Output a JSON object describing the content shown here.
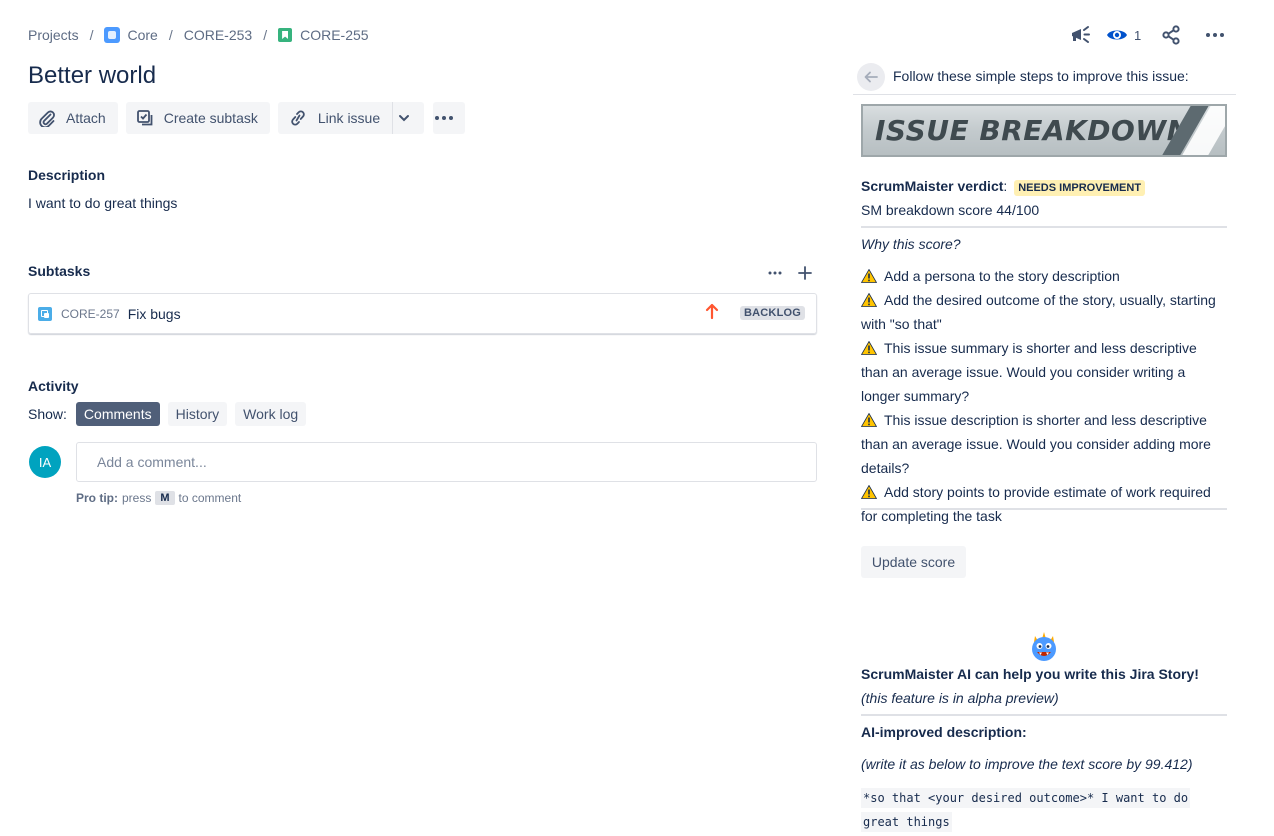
{
  "breadcrumb": {
    "projects": "Projects",
    "project": "Core",
    "parent": "CORE-253",
    "current": "CORE-255",
    "separator": "/"
  },
  "header": {
    "watch_count": "1"
  },
  "issue": {
    "title": "Better world"
  },
  "toolbar": {
    "attach": "Attach",
    "create_subtask": "Create subtask",
    "link_issue": "Link issue"
  },
  "description": {
    "heading": "Description",
    "text": "I want to do great things"
  },
  "subtasks": {
    "heading": "Subtasks",
    "items": [
      {
        "key": "CORE-257",
        "summary": "Fix bugs",
        "priority": "High",
        "status": "BACKLOG"
      }
    ]
  },
  "activity": {
    "heading": "Activity",
    "show_label": "Show:",
    "tabs": [
      {
        "label": "Comments",
        "active": true
      },
      {
        "label": "History",
        "active": false
      },
      {
        "label": "Work log",
        "active": false
      }
    ],
    "avatar_initials": "IA",
    "comment_placeholder": "Add a comment...",
    "pro_tip_label": "Pro tip:",
    "pro_tip_pre": "press",
    "pro_tip_key": "M",
    "pro_tip_post": "to comment"
  },
  "panel": {
    "intro": "Follow these simple steps to improve this issue:",
    "banner_text": "ISSUE BREAKDOWN",
    "verdict_label": "ScrumMaister verdict",
    "verdict_colon": ":",
    "verdict_value": "NEEDS IMPROVEMENT",
    "score_text": "SM breakdown score 44/100",
    "why_label": "Why this score?",
    "recommendations": [
      "Add a persona to the story description",
      "Add the desired outcome of the story, usually, starting with \"so that\"",
      "This issue summary is shorter and less descriptive than an average issue. Would you consider writing a longer summary?",
      "This issue description is shorter and less descriptive than an average issue. Would you consider adding more details?",
      "Add story points to provide estimate of work required for completing the task"
    ],
    "update_button": "Update score",
    "ai_heading": "ScrumMaister AI can help you write this Jira Story!",
    "ai_note": "(this feature is in alpha preview)",
    "ai_desc_label": "AI-improved description:",
    "ai_improve_note": "(write it as below to improve the text score by 99.412)",
    "ai_description": "*so that <your desired outcome>* I want to do great things"
  },
  "colors": {
    "text_primary": "#172b4d",
    "text_subtle": "#5e6c84",
    "active_tab": "#505f79",
    "avatar": "#00a3bf",
    "verdict_badge": "#fff0b3",
    "priority_high": "#ff5630",
    "story": "#36b37e",
    "subtask": "#4bade8"
  }
}
